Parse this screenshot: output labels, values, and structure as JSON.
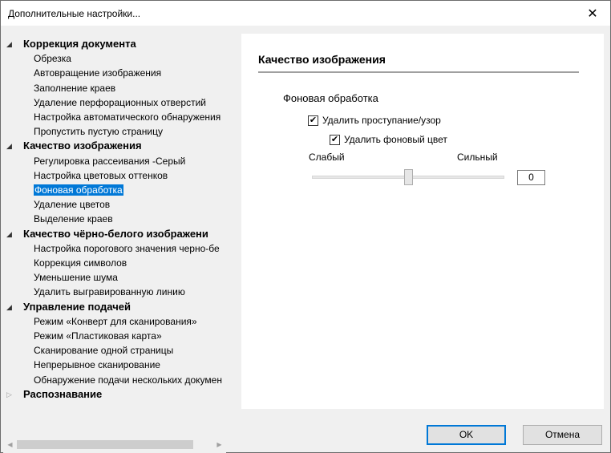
{
  "window": {
    "title": "Дополнительные настройки...",
    "close_glyph": "✕"
  },
  "tree": {
    "groups": [
      {
        "label": "Коррекция документа",
        "expanded": true,
        "children": [
          "Обрезка",
          "Автовращение изображения",
          "Заполнение краев",
          "Удаление перфорационных отверстий",
          "Настройка автоматического обнаружения",
          "Пропустить пустую страницу"
        ]
      },
      {
        "label": "Качество изображения",
        "expanded": true,
        "children": [
          "Регулировка рассеивания -Серый",
          "Настройка цветовых оттенков",
          "Фоновая обработка",
          "Удаление цветов",
          "Выделение краев"
        ]
      },
      {
        "label": "Качество чёрно-белого изображени",
        "expanded": true,
        "children": [
          "Настройка порогового значения черно-бе",
          "Коррекция символов",
          "Уменьшение шума",
          "Удалить выгравированную линию"
        ]
      },
      {
        "label": "Управление подачей",
        "expanded": true,
        "children": [
          "Режим «Конверт для сканирования»",
          "Режим «Пластиковая карта»",
          "Сканирование одной страницы",
          "Непрерывное сканирование",
          "Обнаружение подачи нескольких докумен"
        ]
      },
      {
        "label": "Распознавание",
        "expanded": false,
        "children": []
      }
    ],
    "selected": "Фоновая обработка",
    "icons": {
      "expanded": "triangle-down-icon",
      "collapsed": "triangle-right-icon"
    }
  },
  "panel": {
    "heading": "Качество изображения",
    "section": "Фоновая обработка",
    "remove_bleed": {
      "label": "Удалить проступание/узор",
      "checked": true
    },
    "remove_bg": {
      "label": "Удалить фоновый цвет",
      "checked": true
    },
    "slider": {
      "min_label": "Слабый",
      "max_label": "Сильный",
      "value": "0",
      "position_fraction": 0.5
    }
  },
  "buttons": {
    "ok": "OK",
    "cancel": "Отмена"
  },
  "colors": {
    "selection": "#0078d7",
    "panel_bg": "#ffffff",
    "window_bg": "#f0f0f0"
  }
}
